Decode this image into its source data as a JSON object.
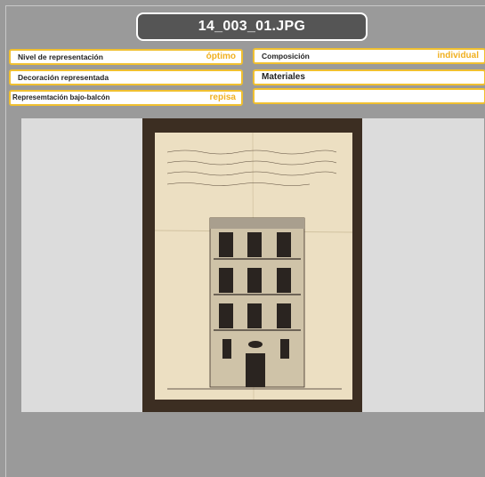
{
  "title": "14_003_01.JPG",
  "fields": {
    "nivel": {
      "label": "Nivel de representación",
      "value": "óptimo"
    },
    "composicion": {
      "label": "Composición",
      "value": "individual"
    },
    "decoracion": {
      "label": "Decoración representada",
      "value": ""
    },
    "materiales": {
      "label": "Materiales",
      "value": ""
    },
    "bajo_balcon": {
      "label": "Represemtación bajo-balcón",
      "value": "repisa"
    },
    "blank": {
      "label": "",
      "value": ""
    }
  },
  "image": {
    "description_icon": "architectural-drawing-image"
  }
}
